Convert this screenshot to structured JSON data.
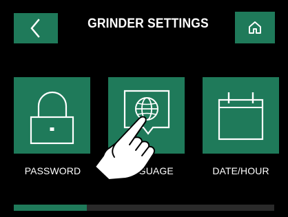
{
  "header": {
    "title": "GRINDER SETTINGS",
    "back_icon": "chevron-left-icon",
    "home_icon": "home-icon"
  },
  "tiles": [
    {
      "label": "PASSWORD",
      "icon": "lock-icon"
    },
    {
      "label": "LANGUAGE",
      "icon": "globe-chat-icon"
    },
    {
      "label": "DATE/HOUR",
      "icon": "calendar-icon"
    }
  ],
  "scroll": {
    "position_fraction": 0.28
  },
  "colors": {
    "accent": "#1f7a5a",
    "background": "#000000",
    "track": "#2a2a2a",
    "text": "#ffffff"
  },
  "overlay": {
    "icon": "pointing-hand-icon"
  }
}
